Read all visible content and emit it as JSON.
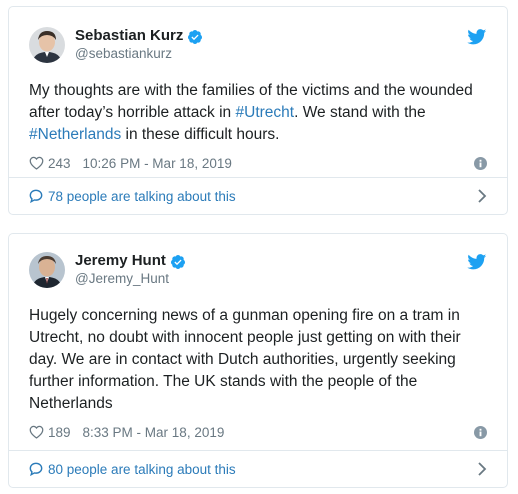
{
  "tweets": [
    {
      "name": "Sebastian Kurz",
      "handle": "@sebastiankurz",
      "text_parts": {
        "p1": "My thoughts are with the families of the victims and the wounded after today’s horrible attack in ",
        "h1": "#Utrecht",
        "p2": ". We stand with the ",
        "h2": "#Netherlands",
        "p3": " in these difficult hours."
      },
      "likes": "243",
      "timestamp": "10:26 PM - Mar 18, 2019",
      "talking": "78 people are talking about this"
    },
    {
      "name": "Jeremy Hunt",
      "handle": "@Jeremy_Hunt",
      "text": "Hugely concerning news of a gunman opening fire on a tram in Utrecht, no doubt with innocent people just getting on with their day. We are in contact with Dutch authorities, urgently seeking further information. The UK stands with the people of the Netherlands",
      "likes": "189",
      "timestamp": "8:33 PM - Mar 18, 2019",
      "talking": "80 people are talking about this"
    }
  ],
  "colors": {
    "link": "#2b7bb9",
    "twitter_blue": "#1da1f2",
    "muted": "#697882",
    "border": "#e1e8ed"
  },
  "icons": [
    "verified-icon",
    "twitter-bird-icon",
    "heart-icon",
    "info-icon",
    "chat-icon",
    "chevron-right-icon"
  ]
}
